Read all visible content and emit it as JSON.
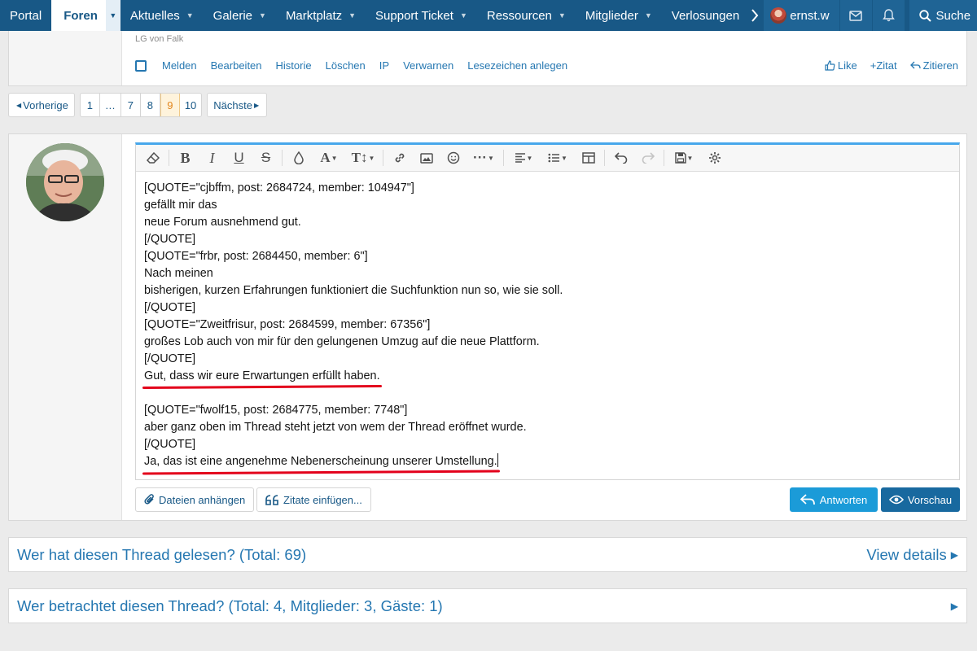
{
  "nav": {
    "tabs": [
      {
        "label": "Portal",
        "has_menu": false
      },
      {
        "label": "Foren",
        "has_menu": true,
        "active": true
      },
      {
        "label": "Aktuelles",
        "has_menu": true
      },
      {
        "label": "Galerie",
        "has_menu": true
      },
      {
        "label": "Marktplatz",
        "has_menu": true
      },
      {
        "label": "Support Ticket",
        "has_menu": true
      },
      {
        "label": "Ressourcen",
        "has_menu": true
      },
      {
        "label": "Mitglieder",
        "has_menu": true
      },
      {
        "label": "Verlosungen",
        "has_menu": false
      }
    ],
    "username": "ernst.w",
    "search_label": "Suche",
    "icons": [
      "chevron-right-icon",
      "envelope-icon",
      "bell-icon",
      "search-icon"
    ],
    "colors": {
      "bar": "#185886",
      "user_area": "#1f6495"
    }
  },
  "prev_post": {
    "signature": "LG von Falk",
    "actions": [
      "Melden",
      "Bearbeiten",
      "Historie",
      "Löschen",
      "IP",
      "Verwarnen",
      "Lesezeichen anlegen"
    ],
    "reactions": {
      "like": "Like",
      "zitat": "Zitat",
      "zitieren": "Zitieren"
    }
  },
  "pagination": {
    "prev": "Vorherige",
    "next": "Nächste",
    "pages": [
      "1",
      "…",
      "7",
      "8",
      "9",
      "10"
    ],
    "current": "9"
  },
  "editor": {
    "toolbar_icons": [
      "eraser-icon",
      "bold-icon",
      "italic-icon",
      "underline-icon",
      "strikethrough-icon",
      "color-drop-icon",
      "font-family-icon",
      "font-size-icon",
      "link-icon",
      "image-icon",
      "smiley-icon",
      "more-icon",
      "align-icon",
      "list-icon",
      "table-icon",
      "undo-icon",
      "redo-icon",
      "drafts-icon",
      "settings-icon"
    ],
    "lines": {
      "l1": "[QUOTE=\"cjbffm, post: 2684724, member: 104947\"]",
      "l2": "gefällt mir das",
      "l3": "neue Forum ausnehmend gut.",
      "l4": "[/QUOTE]",
      "l5": "[QUOTE=\"frbr, post: 2684450, member: 6\"]",
      "l6": "Nach meinen",
      "l7": "bisherigen, kurzen Erfahrungen funktioniert die Suchfunktion nun so, wie sie soll.",
      "l8": "[/QUOTE]",
      "l9": "[QUOTE=\"Zweitfrisur, post: 2684599, member: 67356\"]",
      "l10": "großes Lob auch von mir für den gelungenen Umzug auf die neue Plattform.",
      "l11": "[/QUOTE]",
      "l12": "Gut, dass wir eure Erwartungen erfüllt haben.",
      "l13": "",
      "l14": "[QUOTE=\"fwolf15, post: 2684775, member: 7748\"]",
      "l15": "aber ganz oben im Thread steht jetzt von wem der Thread eröffnet wurde.",
      "l16": "[/QUOTE]",
      "l17": "Ja, das ist eine angenehme Nebenerscheinung unserer Umstellung."
    },
    "underline_color": "#e3001b",
    "buttons": {
      "attach": "Dateien anhängen",
      "insert_quotes": "Zitate einfügen...",
      "reply": "Antworten",
      "preview": "Vorschau"
    },
    "colors": {
      "reply": "#1b9bd8",
      "preview": "#18699f",
      "accent_border": "#47a7eb"
    }
  },
  "readers_block": {
    "title": "Wer hat diesen Thread gelesen? (Total: 69)",
    "link": "View details"
  },
  "viewers_block": {
    "title": "Wer betrachtet diesen Thread? (Total: 4, Mitglieder: 3, Gäste: 1)"
  }
}
